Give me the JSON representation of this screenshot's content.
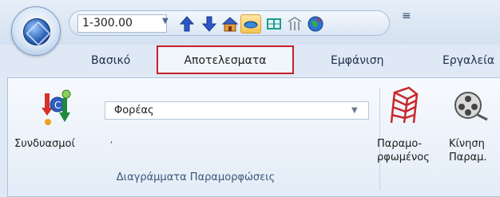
{
  "quick_access": {
    "scale_value": "1-300.00",
    "overflow_label": "≡"
  },
  "tabs": {
    "basic": "Βασικό",
    "results": "Αποτελεσματα",
    "view": "Εμφάνιση",
    "tools": "Εργαλεία"
  },
  "ribbon": {
    "combinations_label": "Συνδυασμοί",
    "carrier_select": "Φορέας",
    "deformed_label_1": "Παραμο-",
    "deformed_label_2": "ρφωμένος",
    "motion_label_1": "Κίνηση",
    "motion_label_2": "Παραμ.",
    "group_label": "Διαγράμματα Παραμορφώσεις"
  },
  "colors": {
    "active_tab_border": "#c8202a",
    "accent_blue": "#2a56c6"
  }
}
